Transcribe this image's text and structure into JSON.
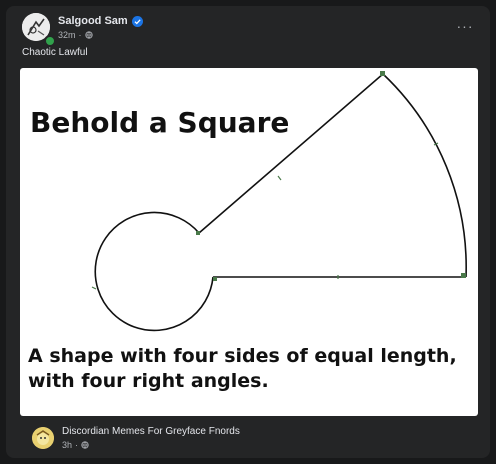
{
  "post": {
    "author": "Salgood Sam",
    "time": "32m",
    "meta_sep": "·",
    "more_label": "···",
    "caption": "Chaotic Lawful"
  },
  "meme": {
    "title": "Behold a Square",
    "subtitle": "A shape with four sides of equal length, with four right angles."
  },
  "shared": {
    "group_name": "Discordian Memes For Greyface Fnords",
    "time": "3h",
    "meta_sep": "·"
  },
  "colors": {
    "background": "#18191a",
    "card": "#242526",
    "primary_text": "#e4e6eb",
    "secondary_text": "#b0b3b8",
    "verified": "#1b74e4",
    "online": "#31a24c"
  },
  "icons": {
    "verified": "verified-badge-icon",
    "privacy": "globe-icon",
    "more": "more-horizontal-icon"
  }
}
